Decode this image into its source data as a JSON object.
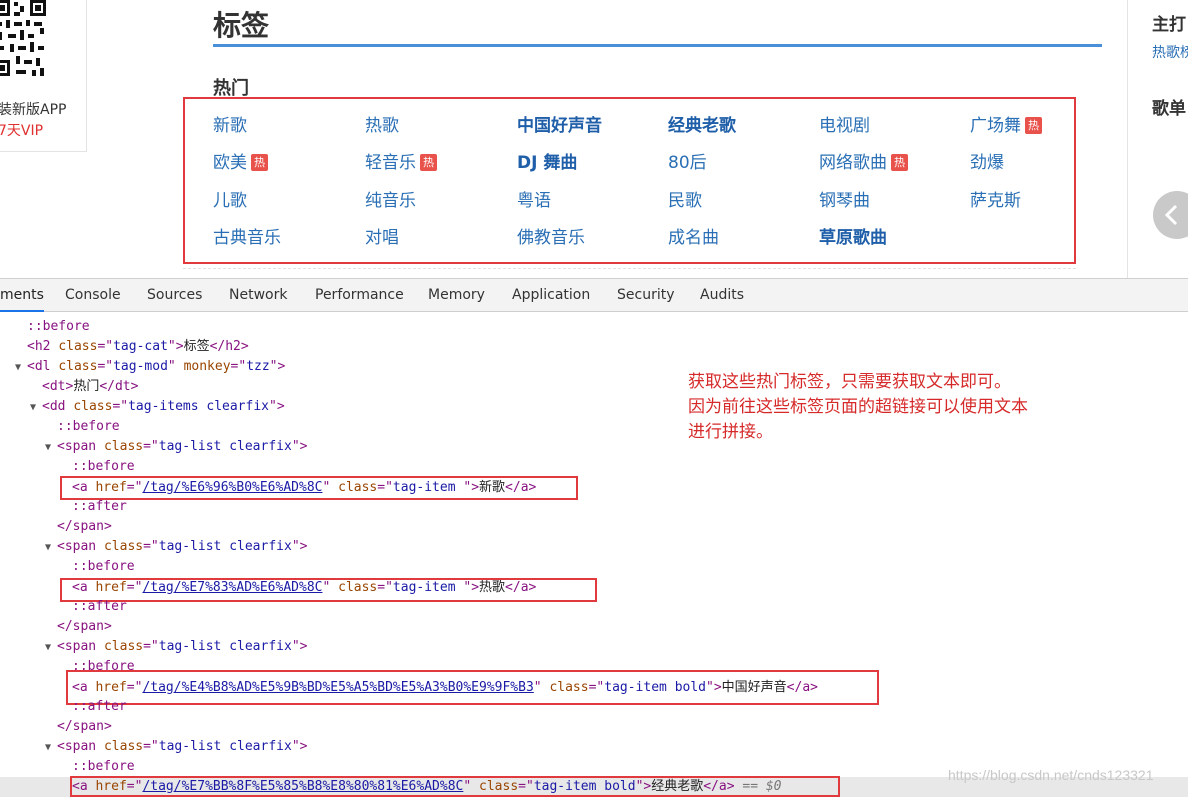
{
  "left_card": {
    "app_text": "装新版APP",
    "vip_text": "7天VIP"
  },
  "page": {
    "title": "标签",
    "hot_label": "热门"
  },
  "tags": [
    {
      "label": "新歌",
      "bold": false,
      "hot": false
    },
    {
      "label": "热歌",
      "bold": false,
      "hot": false
    },
    {
      "label": "中国好声音",
      "bold": true,
      "hot": false
    },
    {
      "label": "经典老歌",
      "bold": true,
      "hot": false
    },
    {
      "label": "电视剧",
      "bold": false,
      "hot": false
    },
    {
      "label": "广场舞",
      "bold": false,
      "hot": true
    },
    {
      "label": "欧美",
      "bold": false,
      "hot": true
    },
    {
      "label": "轻音乐",
      "bold": false,
      "hot": true
    },
    {
      "label": "DJ 舞曲",
      "bold": true,
      "hot": false
    },
    {
      "label": "80后",
      "bold": false,
      "hot": false
    },
    {
      "label": "网络歌曲",
      "bold": false,
      "hot": true
    },
    {
      "label": "劲爆",
      "bold": false,
      "hot": false
    },
    {
      "label": "儿歌",
      "bold": false,
      "hot": false
    },
    {
      "label": "纯音乐",
      "bold": false,
      "hot": false
    },
    {
      "label": "粤语",
      "bold": false,
      "hot": false
    },
    {
      "label": "民歌",
      "bold": false,
      "hot": false
    },
    {
      "label": "钢琴曲",
      "bold": false,
      "hot": false
    },
    {
      "label": "萨克斯",
      "bold": false,
      "hot": false
    },
    {
      "label": "古典音乐",
      "bold": false,
      "hot": false
    },
    {
      "label": "对唱",
      "bold": false,
      "hot": false
    },
    {
      "label": "佛教音乐",
      "bold": false,
      "hot": false
    },
    {
      "label": "成名曲",
      "bold": false,
      "hot": false
    },
    {
      "label": "草原歌曲",
      "bold": true,
      "hot": false
    }
  ],
  "hot_badge": "热",
  "right_panel": {
    "title": "主打",
    "link": "热歌榜",
    "list_title": "歌单"
  },
  "devtools_tabs": [
    "ments",
    "Console",
    "Sources",
    "Network",
    "Performance",
    "Memory",
    "Application",
    "Security",
    "Audits"
  ],
  "active_tab": "ments",
  "tree": {
    "before": "::before",
    "after": "::after",
    "h2_text": "标签",
    "dt_text": "热门",
    "dl_class": "tag-mod",
    "dl_monkey": "tzz",
    "h2_class": "tag-cat",
    "dd_class": "tag-items clearfix",
    "span_class": "tag-list clearfix",
    "links": [
      {
        "href": "/tag/%E6%96%B0%E6%AD%8C",
        "class": "tag-item ",
        "text": "新歌"
      },
      {
        "href": "/tag/%E7%83%AD%E6%AD%8C",
        "class": "tag-item ",
        "text": "热歌"
      },
      {
        "href": "/tag/%E4%B8%AD%E5%9B%BD%E5%A5%BD%E5%A3%B0%E9%9F%B3",
        "class": "tag-item bold",
        "text": "中国好声音"
      },
      {
        "href": "/tag/%E7%BB%8F%E5%85%B8%E8%80%81%E6%AD%8C",
        "class": "tag-item bold",
        "text": "经典老歌"
      }
    ],
    "selected_suffix": "== $0"
  },
  "note": [
    "获取这些热门标签，只需要获取文本即可。",
    "因为前往这些标签页面的超链接可以使用文本",
    "进行拼接。"
  ],
  "watermark": "https://blog.csdn.net/cnds123321"
}
